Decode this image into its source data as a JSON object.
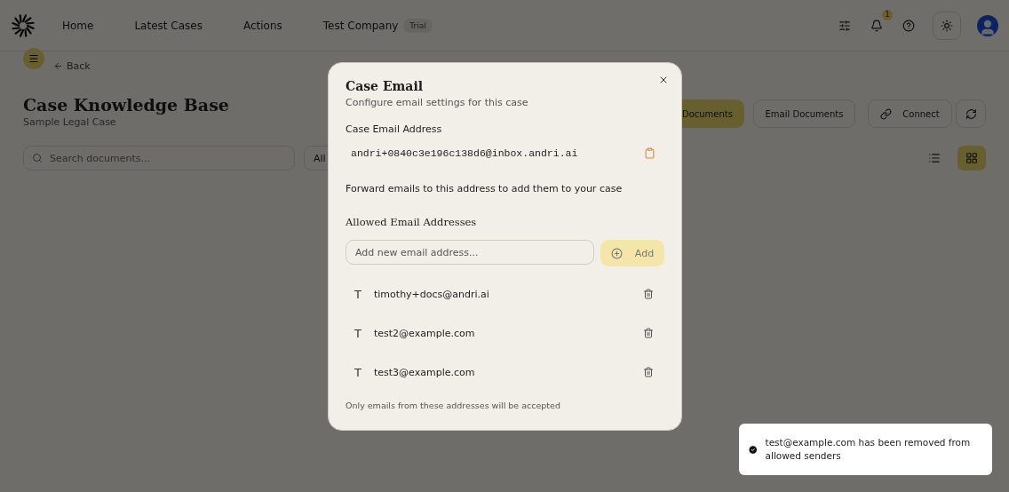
{
  "header": {
    "nav": [
      {
        "label": "Home"
      },
      {
        "label": "Latest Cases"
      },
      {
        "label": "Actions"
      },
      {
        "label": "Test Company",
        "badge": "Trial"
      }
    ],
    "notification_count": "1"
  },
  "page": {
    "back": "Back",
    "title": "Case Knowledge Base",
    "subtitle": "Sample Legal Case",
    "search_placeholder": "Search documents...",
    "filter": "All",
    "actions": [
      {
        "label": "Documents",
        "kind": "primary"
      },
      {
        "label": "Email Documents",
        "kind": "outline"
      },
      {
        "label": "Connect",
        "kind": "link"
      },
      {
        "kind": "refresh"
      }
    ],
    "views": [
      {
        "kind": "list",
        "selected": false
      },
      {
        "kind": "grid",
        "selected": true
      }
    ]
  },
  "dialog": {
    "title": "Case Email",
    "description": "Configure email settings for this case",
    "address_label": "Case Email Address",
    "address": "andri+0840c3e196c138d6@inbox.andri.ai",
    "forward_note": "Forward emails to this address to add them to your case",
    "allowed_title": "Allowed Email Addresses",
    "input_placeholder": "Add new email address...",
    "add_button": "Add",
    "allowed": [
      {
        "initial": "T",
        "email": "timothy+docs@andri.ai"
      },
      {
        "initial": "T",
        "email": "test2@example.com"
      },
      {
        "initial": "T",
        "email": "test3@example.com"
      }
    ],
    "footnote": "Only emails from these addresses will be accepted"
  },
  "toast": {
    "message": "test@example.com has been removed from allowed senders"
  }
}
